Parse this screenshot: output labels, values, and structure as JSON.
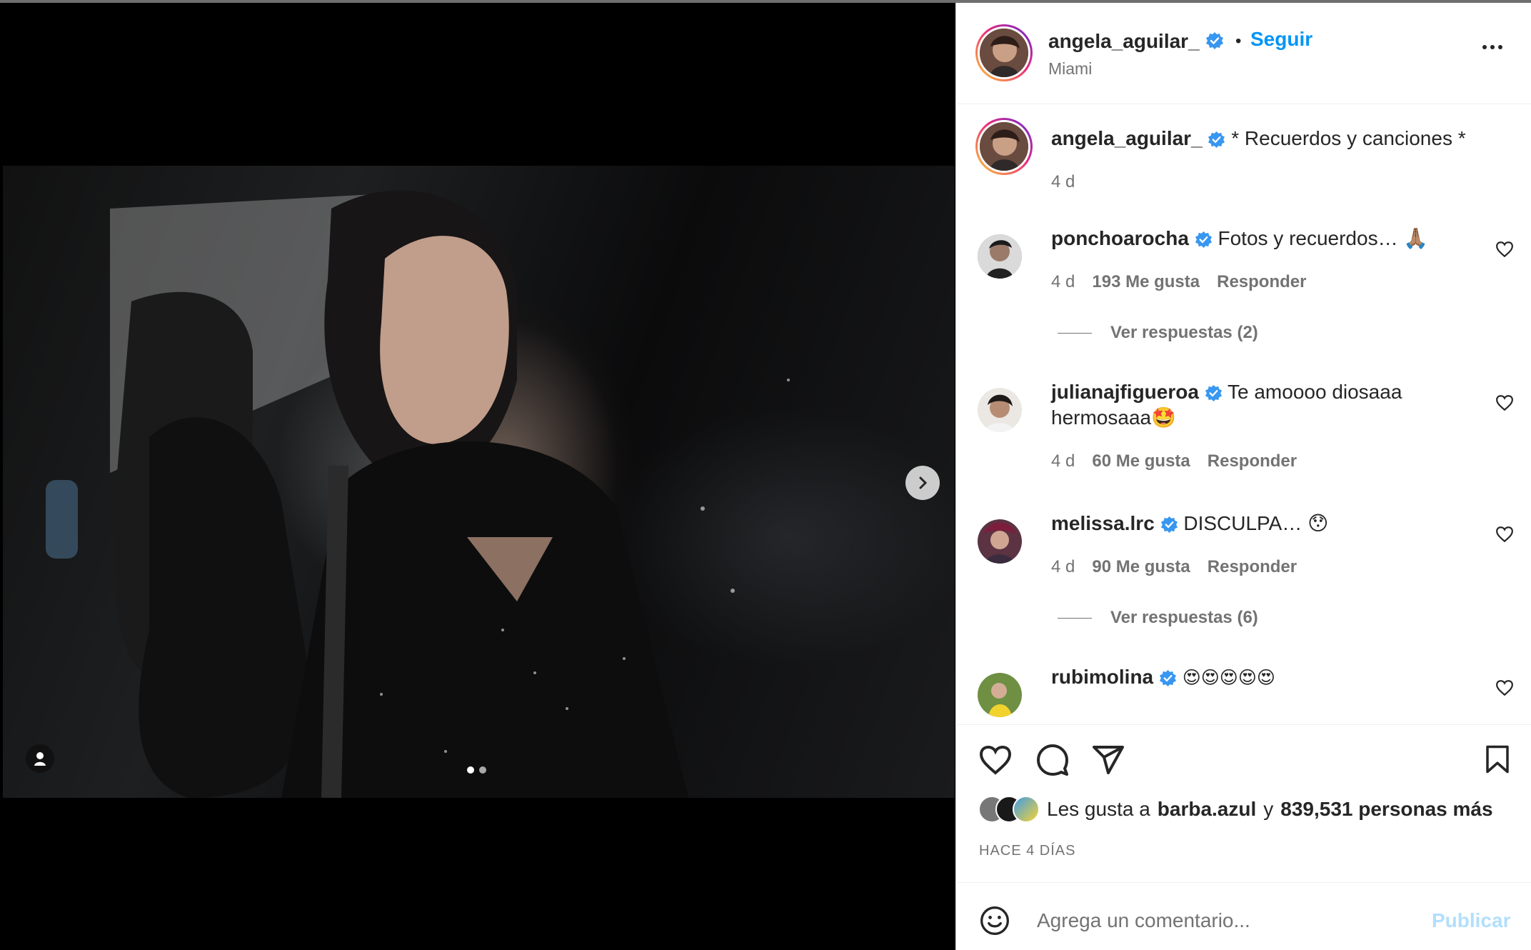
{
  "post": {
    "username": "angela_aguilar_",
    "location": "Miami",
    "follow_label": "Seguir",
    "caption": "* Recuerdos y canciones *",
    "caption_time": "4 d"
  },
  "comments": [
    {
      "username": "ponchoarocha",
      "text": "Fotos y recuerdos… 🙏🏽",
      "time": "4 d",
      "likes": "193 Me gusta",
      "reply": "Responder",
      "replies": "Ver respuestas (2)"
    },
    {
      "username": "julianajfigueroa",
      "text": "Te amoooo diosaaa hermosaaa🤩",
      "time": "4 d",
      "likes": "60 Me gusta",
      "reply": "Responder"
    },
    {
      "username": "melissa.lrc",
      "text": "DISCULPA… 😯",
      "time": "4 d",
      "likes": "90 Me gusta",
      "reply": "Responder",
      "replies": "Ver respuestas (6)"
    },
    {
      "username": "rubimolina",
      "text": "😍😍😍😍😍"
    }
  ],
  "likes": {
    "prefix": "Les gusta a",
    "first_user": "barba.azul",
    "joiner": "y",
    "count_text": "839,531 personas más"
  },
  "date": "HACE 4 DÍAS",
  "composer": {
    "placeholder": "Agrega un comentario...",
    "publish_label": "Publicar"
  },
  "colors": {
    "accent": "#0095f6",
    "verified": "#3897f0",
    "muted": "#737373",
    "publish_disabled": "#b2dffc"
  },
  "icons": [
    "chevron-right-icon",
    "user-tag-icon",
    "verified-badge-icon",
    "more-options-icon",
    "heart-icon",
    "comment-icon",
    "share-icon",
    "bookmark-icon",
    "emoji-icon"
  ]
}
